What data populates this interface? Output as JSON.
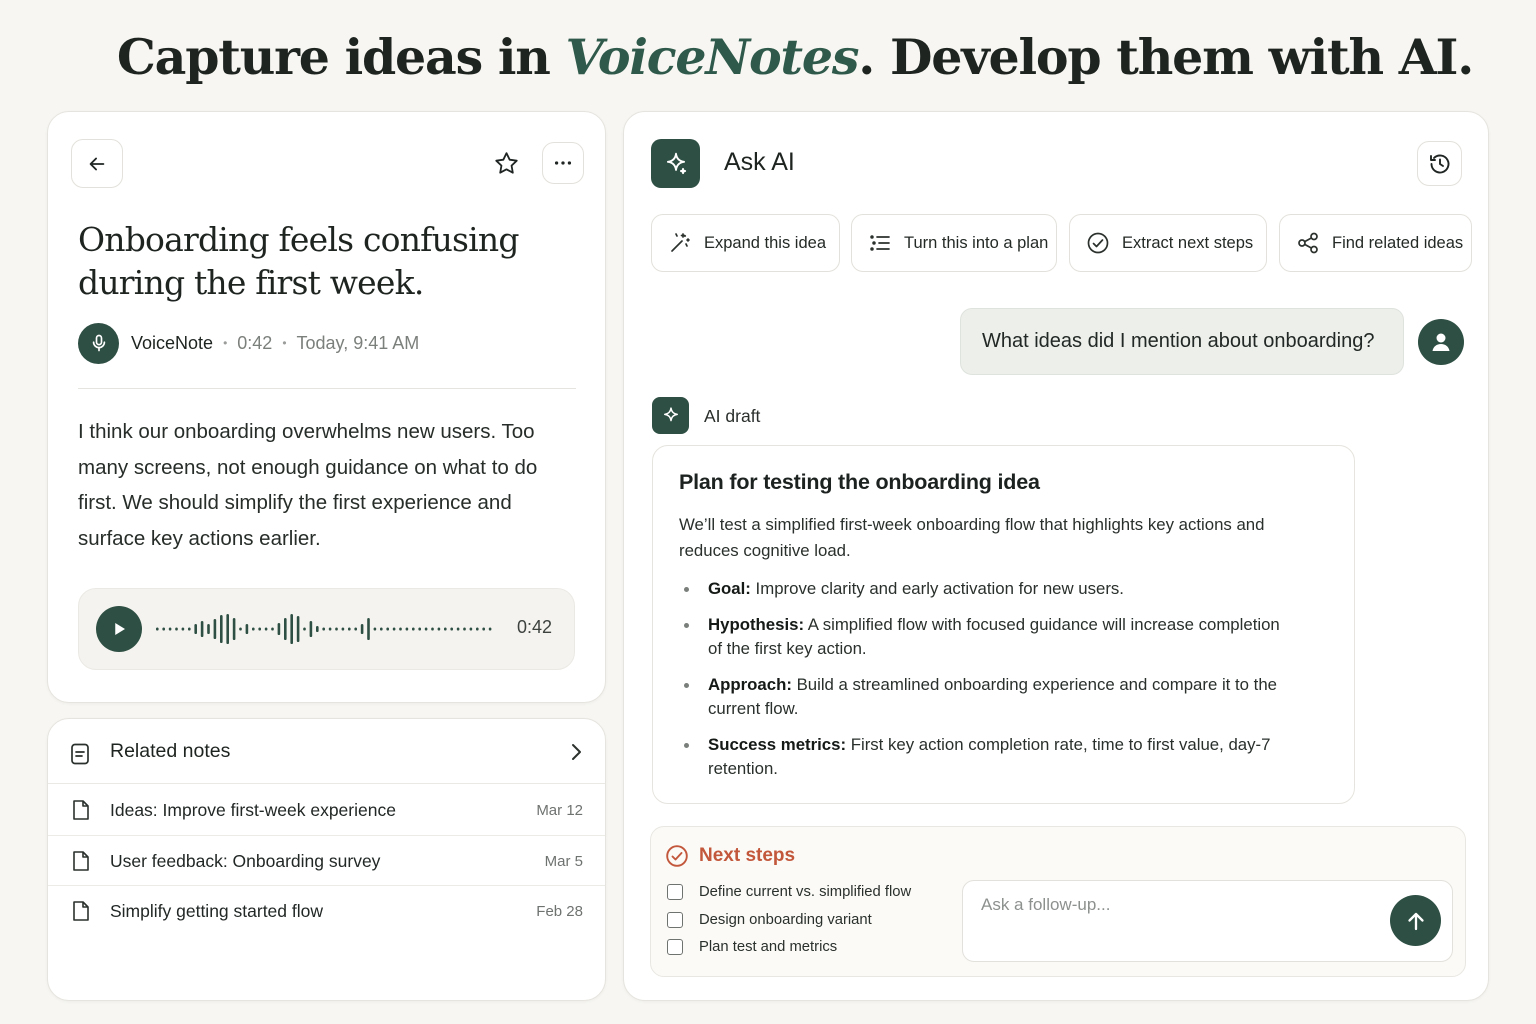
{
  "headline": {
    "before": "Capture ideas in ",
    "accent": "VoiceNotes",
    "after": ". Develop them with AI."
  },
  "note": {
    "title": "Onboarding feels confusing during the first week.",
    "source": "VoiceNote",
    "duration": "0:42",
    "timestamp": "Today, 9:41 AM",
    "transcript": "I think our onboarding overwhelms new users. Too many screens, not enough guidance on what to do first. We should simplify the first experience and surface key actions earlier.",
    "player_duration": "0:42",
    "icons": {
      "back": "arrow-left-icon",
      "favorite": "star-icon",
      "more": "more-horizontal-icon",
      "mic": "microphone-icon",
      "play": "play-icon"
    }
  },
  "related": {
    "title": "Related notes",
    "items": [
      {
        "name": "Ideas: Improve first-week experience",
        "date": "Mar 12"
      },
      {
        "name": "User feedback: Onboarding survey",
        "date": "Mar 5"
      },
      {
        "name": "Simplify getting started flow",
        "date": "Feb 28"
      }
    ]
  },
  "ai": {
    "title": "Ask AI",
    "actions": [
      {
        "label": "Expand this idea",
        "icon": "magic-wand-icon"
      },
      {
        "label": "Turn this into a plan",
        "icon": "list-icon"
      },
      {
        "label": "Extract next steps",
        "icon": "check-circle-icon"
      },
      {
        "label": "Find related ideas",
        "icon": "share-nodes-icon"
      }
    ],
    "user_message": "What ideas did I mention about onboarding?",
    "draft_label": "AI draft",
    "draft": {
      "title": "Plan for testing the onboarding idea",
      "intro": "We’ll test a simplified first-week onboarding flow that highlights key actions and reduces cognitive load.",
      "bullets": [
        {
          "term": "Goal:",
          "text": " Improve clarity and early activation for new users."
        },
        {
          "term": "Hypothesis:",
          "text": " A simplified flow with focused guidance will increase completion of the first key action."
        },
        {
          "term": "Approach:",
          "text": " Build a streamlined onboarding experience and compare it to the current flow."
        },
        {
          "term": "Success metrics:",
          "text": " First key action completion rate, time to first value, day-7 retention."
        }
      ]
    },
    "next_steps": {
      "title": "Next steps",
      "items": [
        {
          "label": "Define current vs. simplified flow",
          "checked": false
        },
        {
          "label": "Design onboarding variant",
          "checked": false
        },
        {
          "label": "Plan test and metrics",
          "checked": false
        }
      ]
    },
    "followup_placeholder": "Ask a follow-up...",
    "colors": {
      "brand": "#2e4f43",
      "accent_orange": "#c2573b",
      "accent_green": "#2f5a4b"
    }
  }
}
